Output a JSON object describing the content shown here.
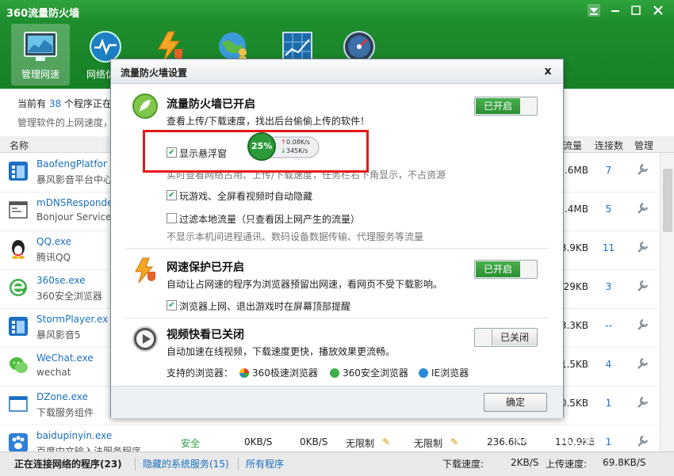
{
  "app": {
    "title": "360流量防火墙"
  },
  "toolbar": {
    "items": [
      {
        "label": "管理网速",
        "icon": "monitor-icon"
      },
      {
        "label": "网络优化",
        "icon": "speedometer-icon"
      },
      {
        "label": "",
        "icon": "lightning-shield-icon"
      },
      {
        "label": "",
        "icon": "globe-user-icon"
      },
      {
        "label": "",
        "icon": "chart-window-icon"
      },
      {
        "label": "",
        "icon": "gauge-icon"
      }
    ]
  },
  "info": {
    "line1_prefix": "当前有",
    "count": "38",
    "line1_suffix": "个程序正在",
    "line2": "管理软件的上网速度，"
  },
  "columns": {
    "name": "名称",
    "traffic": "流量",
    "connections": "连接数",
    "manage": "管理"
  },
  "processes": [
    {
      "name": "BaofengPlatfor",
      "desc": "暴风影音平台中心",
      "traffic": "5.6MB",
      "connections": "7",
      "icon": "baofeng-icon"
    },
    {
      "name": "mDNSResponde",
      "desc": "Bonjour Service",
      "traffic": "3.4MB",
      "connections": "5",
      "icon": "window-icon"
    },
    {
      "name": "QQ.exe",
      "desc": "腾讯QQ",
      "traffic": "3.9KB",
      "connections": "11",
      "icon": "qq-penguin-icon"
    },
    {
      "name": "360se.exe",
      "desc": "360安全浏览器",
      "traffic": "529KB",
      "connections": "3",
      "icon": "360se-browser-icon"
    },
    {
      "name": "StormPlayer.ex",
      "desc": "暴风影音5",
      "traffic": "3.3KB",
      "connections": "--",
      "icon": "stormplayer-icon"
    },
    {
      "name": "WeChat.exe",
      "desc": "wechat",
      "traffic": "1.5KB",
      "connections": "4",
      "icon": "wechat-icon"
    },
    {
      "name": "DZone.exe",
      "desc": "下载服务组件",
      "traffic": "0.5KB",
      "connections": "1",
      "icon": "window-icon"
    },
    {
      "name": "baidupinyin.exe",
      "desc": "百度中文输入法服务程序",
      "status": "安全",
      "down": "0KB/S",
      "up": "0KB/S",
      "limit1": "无限制",
      "limit2": "无限制",
      "total1": "236.6KB",
      "traffic": "110.9KB",
      "connections": "1",
      "icon": "baidu-paw-icon"
    }
  ],
  "status": {
    "connecting": "正在连接网络的程序(23)",
    "hidden": "隐藏的系统服务(15)",
    "all": "所有程序",
    "down_label": "下载速度:",
    "down_value": "2KB/S",
    "up_label": "上传速度:",
    "up_value": "69.8KB/S"
  },
  "dialog": {
    "title": "流量防火墙设置",
    "close": "x",
    "firewall": {
      "title": "流量防火墙已开启",
      "desc": "查看上传/下载速度，找出后台偷偷上传的软件！",
      "toggle": "已开启"
    },
    "float_check": "显示悬浮窗",
    "float_widget": {
      "percent": "25%",
      "up": "0.08K/s",
      "down": "345K/s"
    },
    "float_hint": "实时查看网络占用、上传/下载速度，任务栏右下角显示，不占资源",
    "game_check": "玩游戏、全屏看视频时自动隐藏",
    "local_check": "过滤本地流量（只查看因上网产生的流量）",
    "local_hint": "不显示本机间进程通讯、数码设备数据传输、代理服务等流量",
    "protect": {
      "title": "网速保护已开启",
      "desc": "自动让占网速的程序为浏览器预留出网速，看网页不受下载影响。",
      "toggle": "已开启"
    },
    "protect_check": "浏览器上网、退出游戏时在屏幕顶部提醒",
    "video": {
      "title": "视频快看已关闭",
      "desc": "自动加速在线视频，下载速度更快，播放效果更流畅。",
      "toggle": "已关闭"
    },
    "browsers_label": "支持的浏览器：",
    "browsers": [
      "360极速浏览器",
      "360安全浏览器",
      "IE浏览器"
    ],
    "ok": "确定"
  },
  "watermark": "Bai 经验",
  "colors": {
    "green": "#2c9a3a",
    "blue": "#1a6fc0",
    "red": "#e8181a"
  }
}
